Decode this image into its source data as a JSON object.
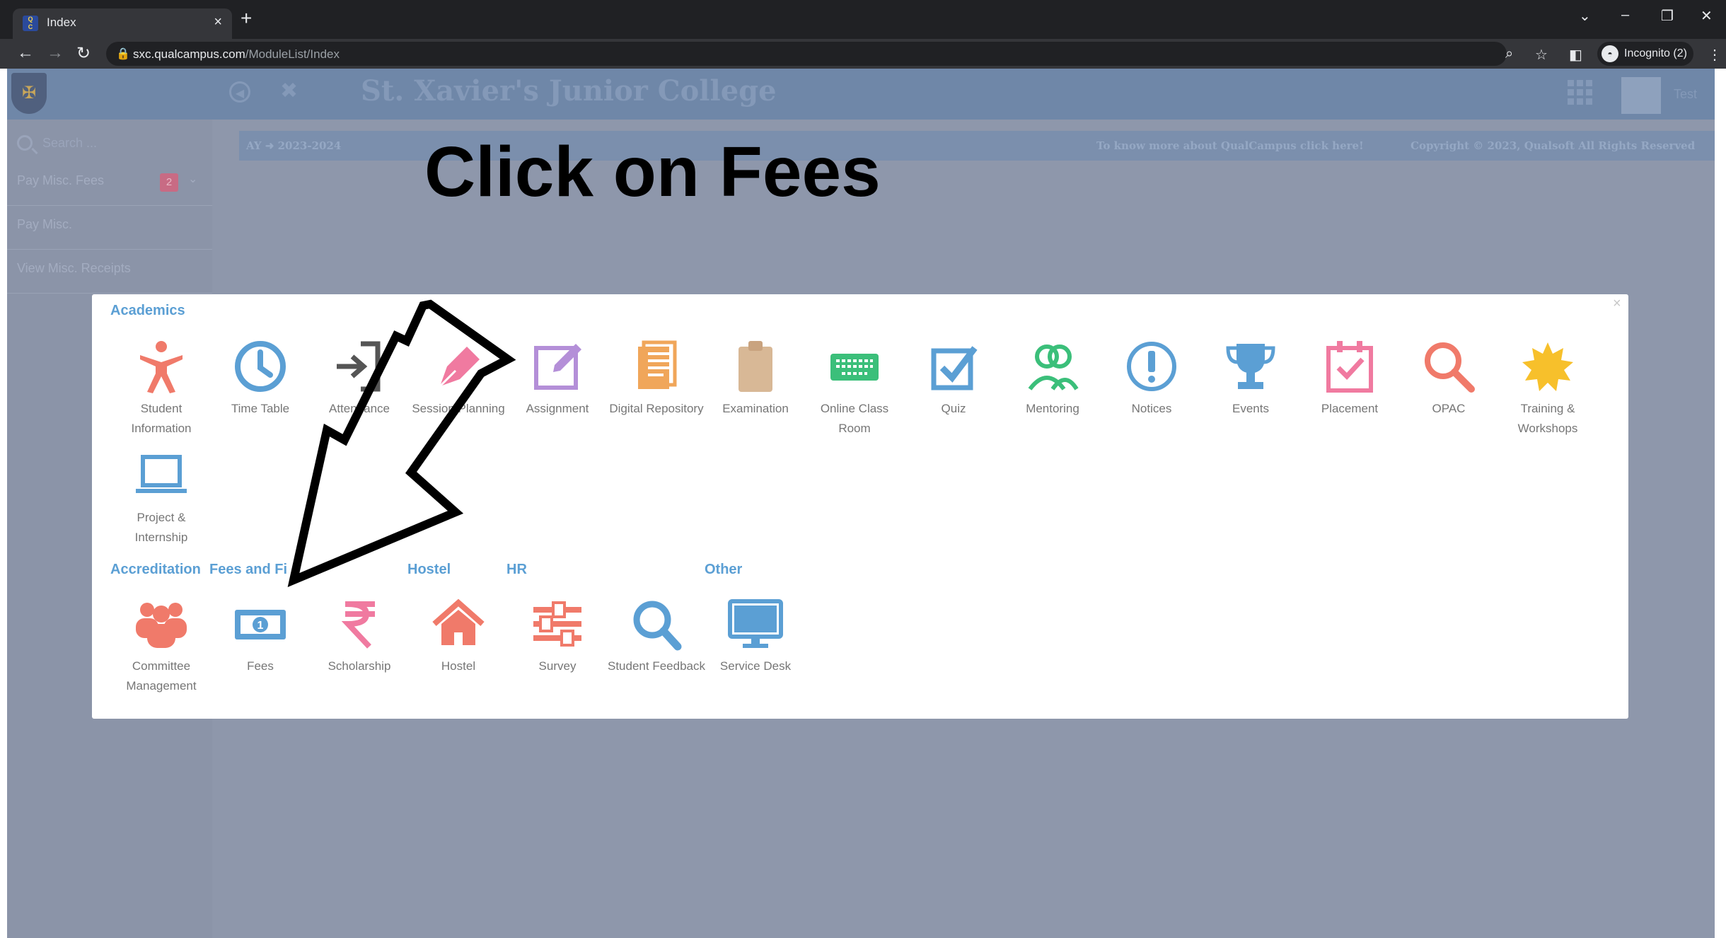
{
  "browser": {
    "tab_title": "Index",
    "favicon_text": "Qual Campus",
    "new_tab": "+",
    "url_host": "sxc.qualcampus.com",
    "url_path": "/ModuleList/Index",
    "incognito_label": "Incognito (2)"
  },
  "header": {
    "college_name": "St. Xavier's Junior College",
    "user_name": "Test"
  },
  "sidebar": {
    "search_placeholder": "Search ...",
    "items": [
      {
        "label": "Pay Misc. Fees",
        "badge": "2"
      },
      {
        "label": "Pay Misc."
      },
      {
        "label": "View Misc. Receipts"
      }
    ]
  },
  "infobar": {
    "academic_year": "AY ➜ 2023-2024",
    "more_info": "To know more about QualCampus click here!",
    "copyright": "Copyright © 2023, Qualsoft All Rights Reserved"
  },
  "instruction": "Click on Fees",
  "modal": {
    "close": "×",
    "sections": {
      "academics": "Academics",
      "accreditation": "Accreditation",
      "fees": "Fees and Fi",
      "hostel": "Hostel",
      "hr": "HR",
      "other": "Other"
    },
    "academics": [
      {
        "label": "Student Information",
        "icon": "person-icon",
        "color": "#f07a6a"
      },
      {
        "label": "Time Table",
        "icon": "clock-icon",
        "color": "#5b9fd4"
      },
      {
        "label": "Attendance",
        "icon": "sign-in-icon",
        "color": "#555555"
      },
      {
        "label": "Session Planning",
        "icon": "pen-icon",
        "color": "#f07aa0"
      },
      {
        "label": "Assignment",
        "icon": "edit-icon",
        "color": "#b48fd8"
      },
      {
        "label": "Digital Repository",
        "icon": "document-icon",
        "color": "#f0a65a"
      },
      {
        "label": "Examination",
        "icon": "clipboard-icon",
        "color": "#d8b896"
      },
      {
        "label": "Online Class Room",
        "icon": "keyboard-icon",
        "color": "#3bbf7a"
      },
      {
        "label": "Quiz",
        "icon": "checkbox-icon",
        "color": "#5b9fd4"
      },
      {
        "label": "Mentoring",
        "icon": "users-icon",
        "color": "#3bbf7a"
      },
      {
        "label": "Notices",
        "icon": "exclamation-icon",
        "color": "#5b9fd4"
      },
      {
        "label": "Events",
        "icon": "trophy-icon",
        "color": "#5b9fd4"
      },
      {
        "label": "Placement",
        "icon": "calendar-check-icon",
        "color": "#f07aa0"
      },
      {
        "label": "OPAC",
        "icon": "magnifier-icon",
        "color": "#f07a6a"
      },
      {
        "label": "Training & Workshops",
        "icon": "sun-icon",
        "color": "#f7c02b"
      },
      {
        "label": "Project & Internship",
        "icon": "laptop-icon",
        "color": "#5b9fd4"
      }
    ],
    "bottom": [
      {
        "label": "Committee Management",
        "icon": "group-icon",
        "color": "#f07a6a"
      },
      {
        "label": "Fees",
        "icon": "money-icon",
        "color": "#5b9fd4"
      },
      {
        "label": "Scholarship",
        "icon": "rupee-icon",
        "color": "#f07aa0"
      },
      {
        "label": "Hostel",
        "icon": "home-icon",
        "color": "#f07a6a"
      },
      {
        "label": "Survey",
        "icon": "sliders-icon",
        "color": "#f07a6a"
      },
      {
        "label": "Student Feedback",
        "icon": "search-feedback-icon",
        "color": "#5b9fd4"
      },
      {
        "label": "Service Desk",
        "icon": "monitor-icon",
        "color": "#5b9fd4"
      }
    ]
  }
}
